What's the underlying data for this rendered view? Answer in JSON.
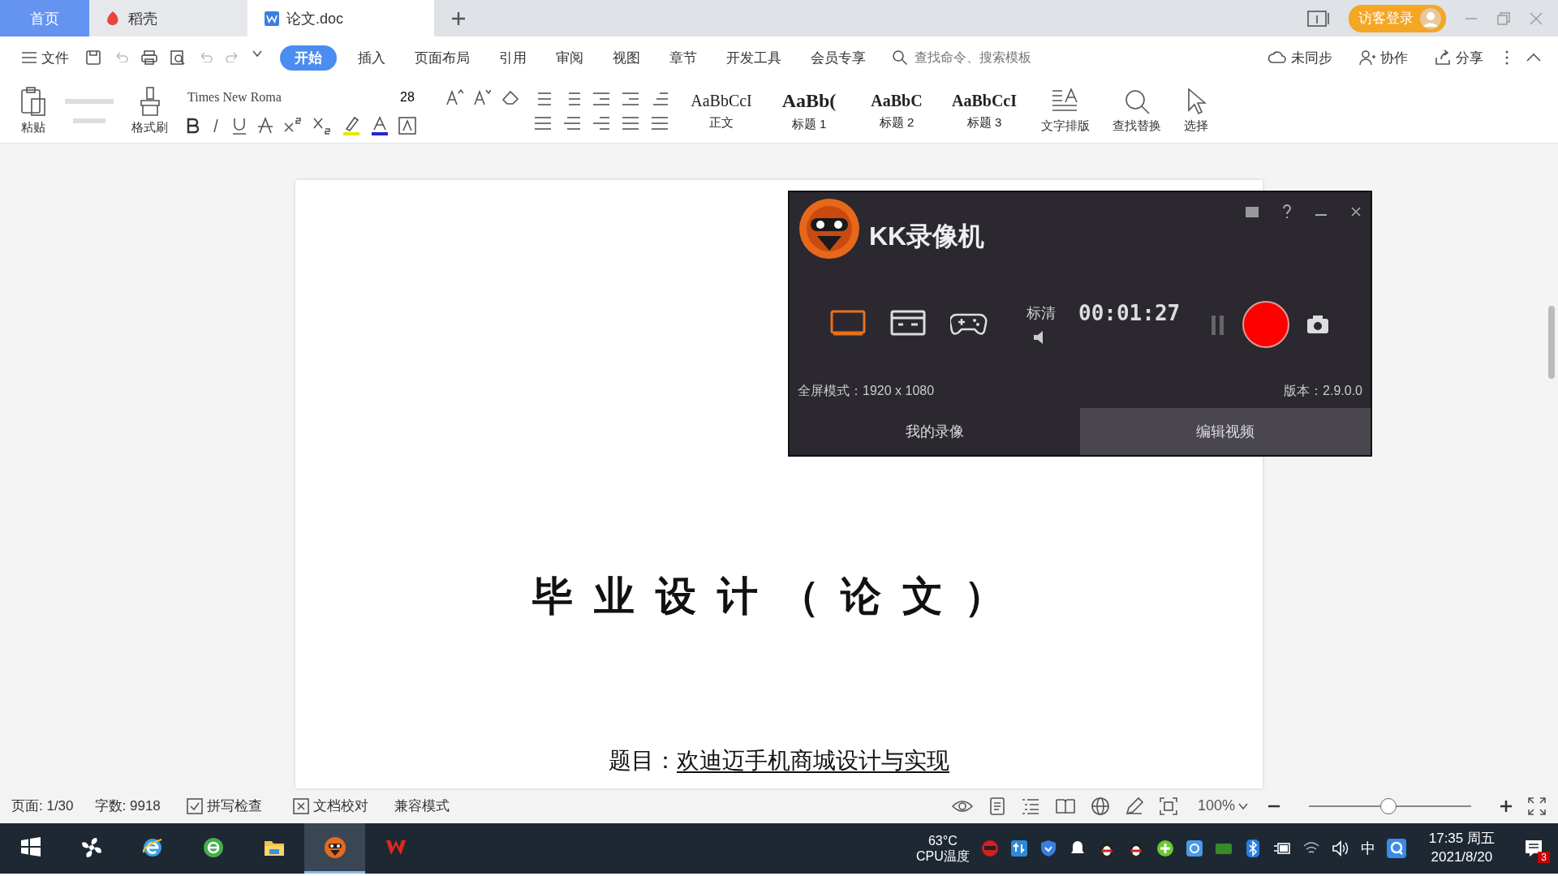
{
  "tabs": [
    {
      "label": "首页",
      "kind": "home",
      "selected": false
    },
    {
      "label": "稻壳",
      "kind": "docer",
      "selected": false
    },
    {
      "label": "论文.doc",
      "kind": "doc",
      "selected": true
    }
  ],
  "login_button": "访客登录",
  "menu": {
    "file": "文件",
    "items": [
      {
        "label": "开始",
        "selected": true
      },
      {
        "label": "插入",
        "selected": false
      },
      {
        "label": "页面布局",
        "selected": false
      },
      {
        "label": "引用",
        "selected": false
      },
      {
        "label": "审阅",
        "selected": false
      },
      {
        "label": "视图",
        "selected": false
      },
      {
        "label": "章节",
        "selected": false
      },
      {
        "label": "开发工具",
        "selected": false
      },
      {
        "label": "会员专享",
        "selected": false
      }
    ],
    "search_placeholder": "查找命令、搜索模板",
    "actions": [
      {
        "label": "未同步",
        "kind": "cloud"
      },
      {
        "label": "协作",
        "kind": "person"
      },
      {
        "label": "分享",
        "kind": "share"
      }
    ]
  },
  "ribbon": {
    "paste": "粘贴",
    "format_painter": "格式刷",
    "font": "Times New Roma",
    "font_size": "28",
    "styles": [
      {
        "preview": "AaBbCcI",
        "label": "正文",
        "kind": "normal"
      },
      {
        "preview": "AaBb(",
        "label": "标题 1",
        "kind": "h1"
      },
      {
        "preview": "AaBbC",
        "label": "标题 2",
        "kind": "h2"
      },
      {
        "preview": "AaBbCcI",
        "label": "标题 3",
        "kind": "h3"
      }
    ],
    "tools": [
      {
        "label": "文字排版",
        "kind": "layout"
      },
      {
        "label": "查找替换",
        "kind": "find"
      },
      {
        "label": "选择",
        "kind": "select"
      }
    ]
  },
  "document": {
    "title": "毕业设计（论文）",
    "subject_label": "题目：",
    "subject": "欢迪迈手机商城设计与实现"
  },
  "recorder": {
    "title": "KK录像机",
    "modes": [
      {
        "kind": "screen",
        "selected": true
      },
      {
        "kind": "window",
        "selected": false
      },
      {
        "kind": "game",
        "selected": false
      }
    ],
    "quality": "标清",
    "timer": "00:01:27",
    "mode_info": "全屏模式：1920 x 1080",
    "version": "版本：2.9.0.0",
    "tabs": [
      {
        "label": "我的录像",
        "selected": false
      },
      {
        "label": "编辑视频",
        "selected": true
      }
    ]
  },
  "status_bar": {
    "page": "页面: 1/30",
    "words": "字数: 9918",
    "checks": [
      {
        "label": "拼写检查",
        "kind": "spell"
      },
      {
        "label": "文档校对",
        "kind": "proof"
      }
    ],
    "mode": "兼容模式",
    "zoom": "100%",
    "zoom_slider": {
      "level": 0.49
    }
  },
  "taskbar": {
    "apps": [
      {
        "kind": "start",
        "selected": false
      },
      {
        "kind": "pinwheel",
        "selected": false
      },
      {
        "kind": "ie",
        "selected": false
      },
      {
        "kind": "browser",
        "selected": false
      },
      {
        "kind": "folder",
        "selected": false
      },
      {
        "kind": "recorder",
        "selected": true
      },
      {
        "kind": "wps",
        "selected": false
      }
    ],
    "cpu_temp": "63°C",
    "cpu_label": "CPU温度",
    "ime": "中",
    "time": "17:35 周五",
    "date": "2021/8/20",
    "notifications": "3"
  }
}
